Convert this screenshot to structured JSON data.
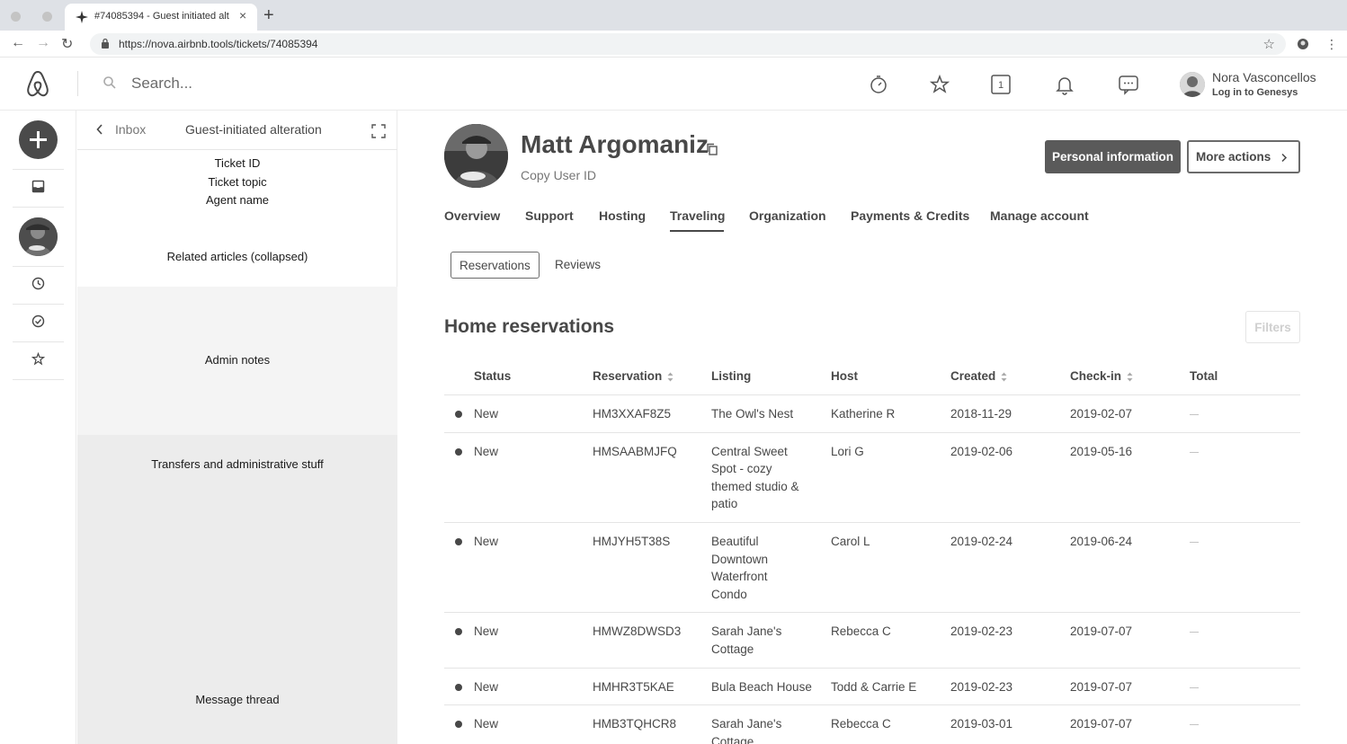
{
  "browser": {
    "tab_title": "#74085394 - Guest initiated alt",
    "url": "https://nova.airbnb.tools/tickets/74085394"
  },
  "header": {
    "search_placeholder": "Search...",
    "notification_count": "1",
    "user_name": "Nora Vasconcellos",
    "user_sub": "Log in to Genesys"
  },
  "panel": {
    "back_label": "Inbox",
    "title": "Guest-initiated alteration",
    "ticket_id": "Ticket ID",
    "ticket_topic": "Ticket topic",
    "agent_name": "Agent name",
    "related_articles": "Related articles (collapsed)",
    "admin_notes": "Admin notes",
    "transfers": "Transfers and administrative stuff",
    "message_thread": "Message thread"
  },
  "profile": {
    "name": "Matt Argomaniz",
    "copy_id": "Copy User ID",
    "btn_personal": "Personal information",
    "btn_more": "More actions"
  },
  "tabs": [
    "Overview",
    "Support",
    "Hosting",
    "Traveling",
    "Organization",
    "Payments & Credits",
    "Manage account"
  ],
  "subtabs": [
    "Reservations",
    "Reviews"
  ],
  "section": {
    "title": "Home reservations",
    "filters": "Filters"
  },
  "table": {
    "headers": [
      "Status",
      "Reservation",
      "Listing",
      "Host",
      "Created",
      "Check-in",
      "Total"
    ],
    "rows": [
      {
        "status": "New",
        "reservation": "HM3XXAF8Z5",
        "listing": [
          "The Owl's Nest"
        ],
        "host": "Katherine R",
        "created": "2018-11-29",
        "checkin": "2019-02-07"
      },
      {
        "status": "New",
        "reservation": "HMSAABMJFQ",
        "listing": [
          "Central Sweet",
          "Spot - cozy",
          "themed studio &",
          "patio"
        ],
        "host": "Lori G",
        "created": "2019-02-06",
        "checkin": "2019-05-16"
      },
      {
        "status": "New",
        "reservation": "HMJYH5T38S",
        "listing": [
          "Beautiful",
          "Downtown",
          "Waterfront",
          "Condo"
        ],
        "host": "Carol L",
        "created": "2019-02-24",
        "checkin": "2019-06-24"
      },
      {
        "status": "New",
        "reservation": "HMWZ8DWSD3",
        "listing": [
          "Sarah Jane's",
          "Cottage"
        ],
        "host": "Rebecca C",
        "created": "2019-02-23",
        "checkin": "2019-07-07"
      },
      {
        "status": "New",
        "reservation": "HMHR3T5KAE",
        "listing": [
          "Bula Beach House"
        ],
        "host": "Todd & Carrie E",
        "created": "2019-02-23",
        "checkin": "2019-07-07"
      },
      {
        "status": "New",
        "reservation": "HMB3TQHCR8",
        "listing": [
          "Sarah Jane's",
          "Cottage"
        ],
        "host": "Rebecca C",
        "created": "2019-03-01",
        "checkin": "2019-07-07"
      }
    ]
  }
}
